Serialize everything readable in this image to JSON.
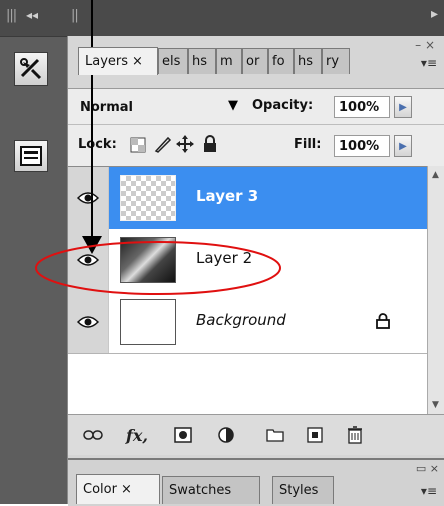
{
  "top_bar": {
    "collapse_glyph": "◂◂"
  },
  "layers_panel": {
    "tabs": [
      {
        "label": "Layers",
        "close": "×",
        "active": true
      },
      {
        "label": "els"
      },
      {
        "label": "hs"
      },
      {
        "label": "m"
      },
      {
        "label": "or"
      },
      {
        "label": "fo"
      },
      {
        "label": "hs"
      },
      {
        "label": "ry"
      }
    ],
    "close_glyph": "– ×",
    "blend_mode": "Normal",
    "opacity_label": "Opacity:",
    "opacity_value": "100%",
    "lock_label": "Lock:",
    "fill_label": "Fill:",
    "fill_value": "100%",
    "layers": [
      {
        "name": "Layer 3",
        "selected": true,
        "italic": false
      },
      {
        "name": "Layer 2",
        "selected": false,
        "italic": false
      },
      {
        "name": "Background",
        "selected": false,
        "italic": true,
        "locked": true
      }
    ],
    "bottom_icons": [
      "link-icon",
      "fx-icon",
      "mask-icon",
      "adjustment-icon",
      "folder-icon",
      "new-layer-icon",
      "trash-icon"
    ],
    "fx_label": "fx"
  },
  "color_panel": {
    "tabs": [
      {
        "label": "Color",
        "close": "×",
        "active": true
      },
      {
        "label": "Swatches"
      },
      {
        "label": "Styles"
      }
    ],
    "close_glyph": "▭ ×"
  },
  "colors": {
    "selection": "#3b8ef0",
    "annotation": "#e01010",
    "panel_bg": "#d6d6d6"
  }
}
